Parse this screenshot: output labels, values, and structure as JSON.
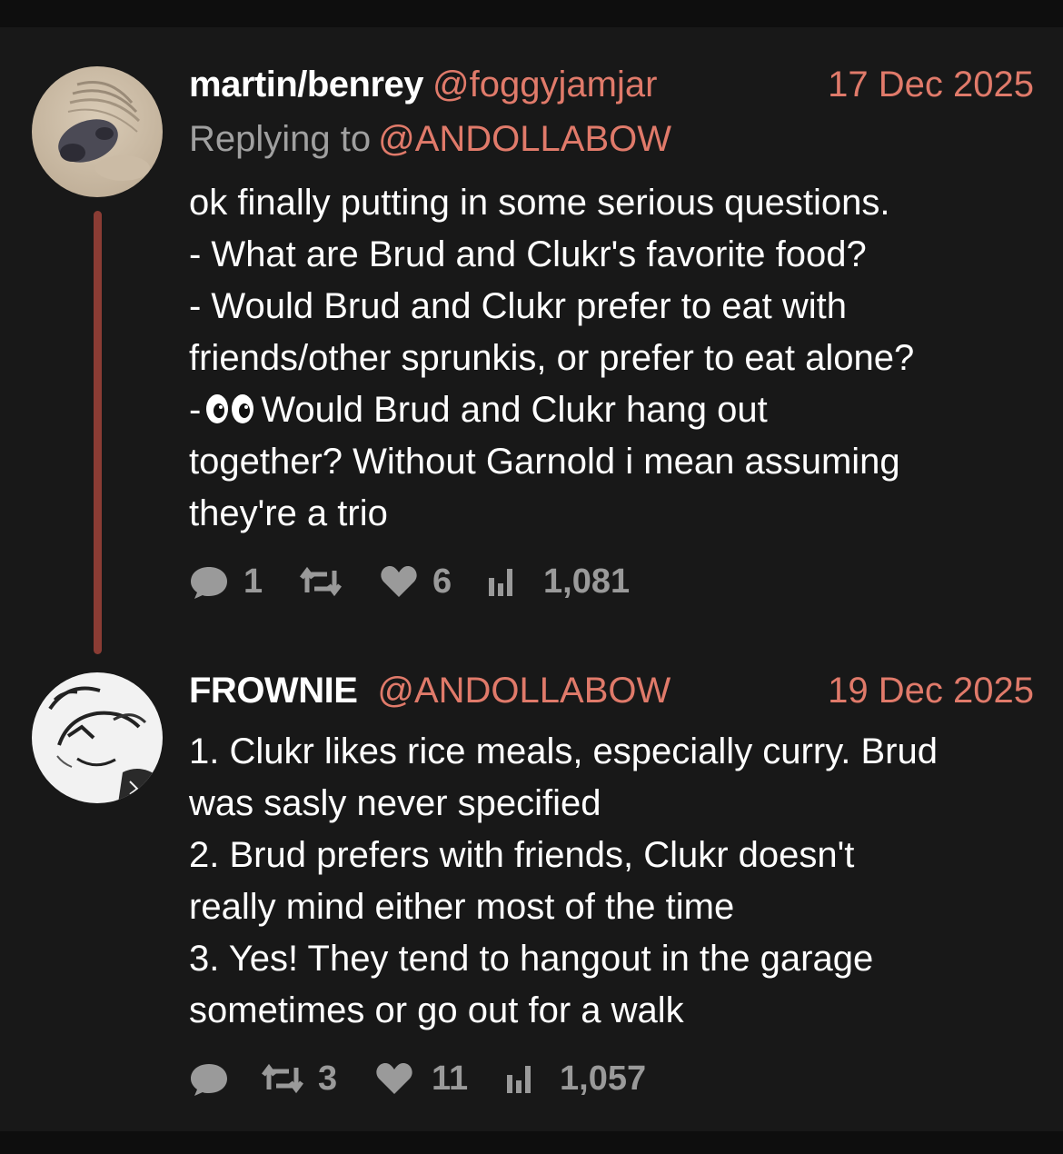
{
  "posts": [
    {
      "display_name": "martin/benrey",
      "handle": "@foggyjamjar",
      "date": "17 Dec 2025",
      "replying_prefix": "Replying to",
      "replying_handle": "@ANDOLLABOW",
      "lines": [
        "ok finally putting in some serious questions.",
        "- What are Brud and Clukr's favorite food?",
        "- Would Brud and Clukr prefer to eat with",
        "friends/other sprunkis, or prefer to eat alone?",
        "Would Brud and Clukr hang out",
        "together? Without Garnold i mean assuming",
        "they're a trio"
      ],
      "eyes_line_prefix": "-",
      "replies": "1",
      "reposts": "",
      "likes": "6",
      "views": "1,081"
    },
    {
      "display_name": "FROWNIE",
      "handle": "@ANDOLLABOW",
      "date": "19 Dec 2025",
      "lines": [
        "1. Clukr likes rice meals, especially curry. Brud",
        "was sasly never specified",
        "2. Brud prefers with friends, Clukr doesn't",
        "really mind either most of the time",
        "3. Yes! They tend to hangout in the garage",
        "sometimes or go out for a walk"
      ],
      "replies": "",
      "reposts": "3",
      "likes": "11",
      "views": "1,057"
    }
  ],
  "icons": {
    "reply": "speech-bubble-icon",
    "repost": "repost-arrows-icon",
    "like": "heart-icon",
    "views": "bar-chart-icon",
    "eyes": "eyes-emoji-icon"
  },
  "colors": {
    "background": "#181818",
    "accent": "#e07a6a",
    "thread_line": "#8a3c34",
    "muted": "#9a9a9a"
  }
}
